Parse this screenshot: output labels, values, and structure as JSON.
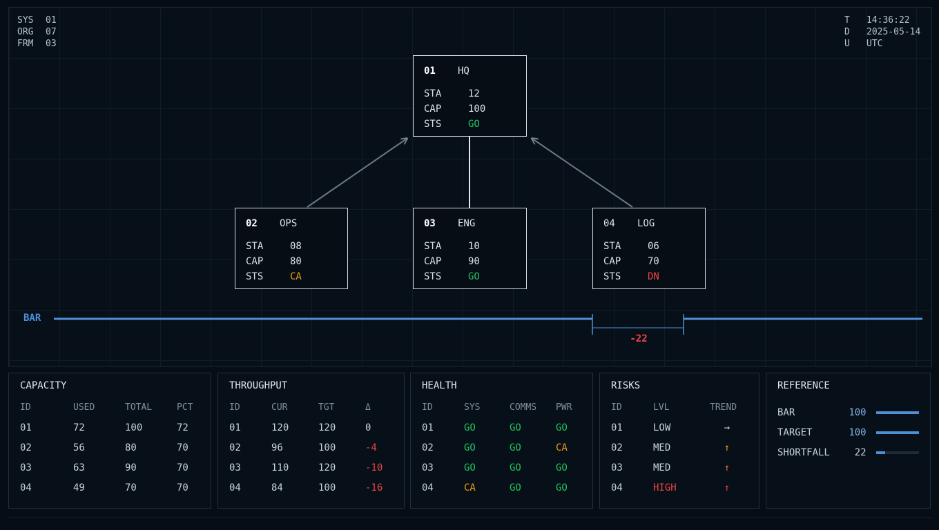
{
  "meta_left": [
    {
      "k": "SYS",
      "v": "01"
    },
    {
      "k": "ORG",
      "v": "07"
    },
    {
      "k": "FRM",
      "v": "03"
    }
  ],
  "meta_right": [
    {
      "k": "T",
      "v": "14:36:22"
    },
    {
      "k": "D",
      "v": "2025-05-14"
    },
    {
      "k": "U",
      "v": "UTC"
    }
  ],
  "nodes": [
    {
      "id": "01",
      "name": "HQ",
      "sta": "12",
      "cap": "100",
      "sts": "GO"
    },
    {
      "id": "02",
      "name": "OPS",
      "sta": "08",
      "cap": "80",
      "sts": "CA"
    },
    {
      "id": "03",
      "name": "ENG",
      "sta": "10",
      "cap": "90",
      "sts": "GO"
    },
    {
      "id": "04",
      "name": "LOG",
      "sta": "06",
      "cap": "70",
      "sts": "DN"
    }
  ],
  "node_labels": {
    "sta": "STA",
    "cap": "CAP",
    "sts": "STS"
  },
  "bar": {
    "label": "BAR",
    "gap": "-22"
  },
  "capacity": {
    "title": "CAPACITY",
    "headers": [
      "ID",
      "USED",
      "TOTAL",
      "PCT"
    ],
    "rows": [
      [
        "01",
        "72",
        "100",
        "72"
      ],
      [
        "02",
        "56",
        "80",
        "70"
      ],
      [
        "03",
        "63",
        "90",
        "70"
      ],
      [
        "04",
        "49",
        "70",
        "70"
      ]
    ]
  },
  "throughput": {
    "title": "THROUGHPUT",
    "headers": [
      "ID",
      "CUR",
      "TGT",
      "Δ"
    ],
    "rows": [
      [
        "01",
        "120",
        "120",
        "0"
      ],
      [
        "02",
        "96",
        "100",
        "-4"
      ],
      [
        "03",
        "110",
        "120",
        "-10"
      ],
      [
        "04",
        "84",
        "100",
        "-16"
      ]
    ]
  },
  "health": {
    "title": "HEALTH",
    "headers": [
      "ID",
      "SYS",
      "COMMS",
      "PWR"
    ],
    "rows": [
      [
        "01",
        "GO",
        "GO",
        "GO"
      ],
      [
        "02",
        "GO",
        "GO",
        "CA"
      ],
      [
        "03",
        "GO",
        "GO",
        "GO"
      ],
      [
        "04",
        "CA",
        "GO",
        "GO"
      ]
    ]
  },
  "risks": {
    "title": "RISKS",
    "headers": [
      "ID",
      "LVL",
      "TREND"
    ],
    "rows": [
      [
        "01",
        "LOW",
        "→"
      ],
      [
        "02",
        "MED",
        "↑"
      ],
      [
        "03",
        "MED",
        "↑"
      ],
      [
        "04",
        "HIGH",
        "↑"
      ]
    ]
  },
  "reference": {
    "title": "REFERENCE",
    "rows": [
      {
        "name": "BAR",
        "value": "100",
        "level": 1.0
      },
      {
        "name": "TARGET",
        "value": "100",
        "level": 1.0
      },
      {
        "name": "SHORTFALL",
        "value": "22",
        "level": 0.22
      }
    ]
  },
  "colors": {
    "go": "#22c55e",
    "caution": "#f59e0b",
    "down": "#ef4444",
    "accent": "#4f8fd8"
  }
}
